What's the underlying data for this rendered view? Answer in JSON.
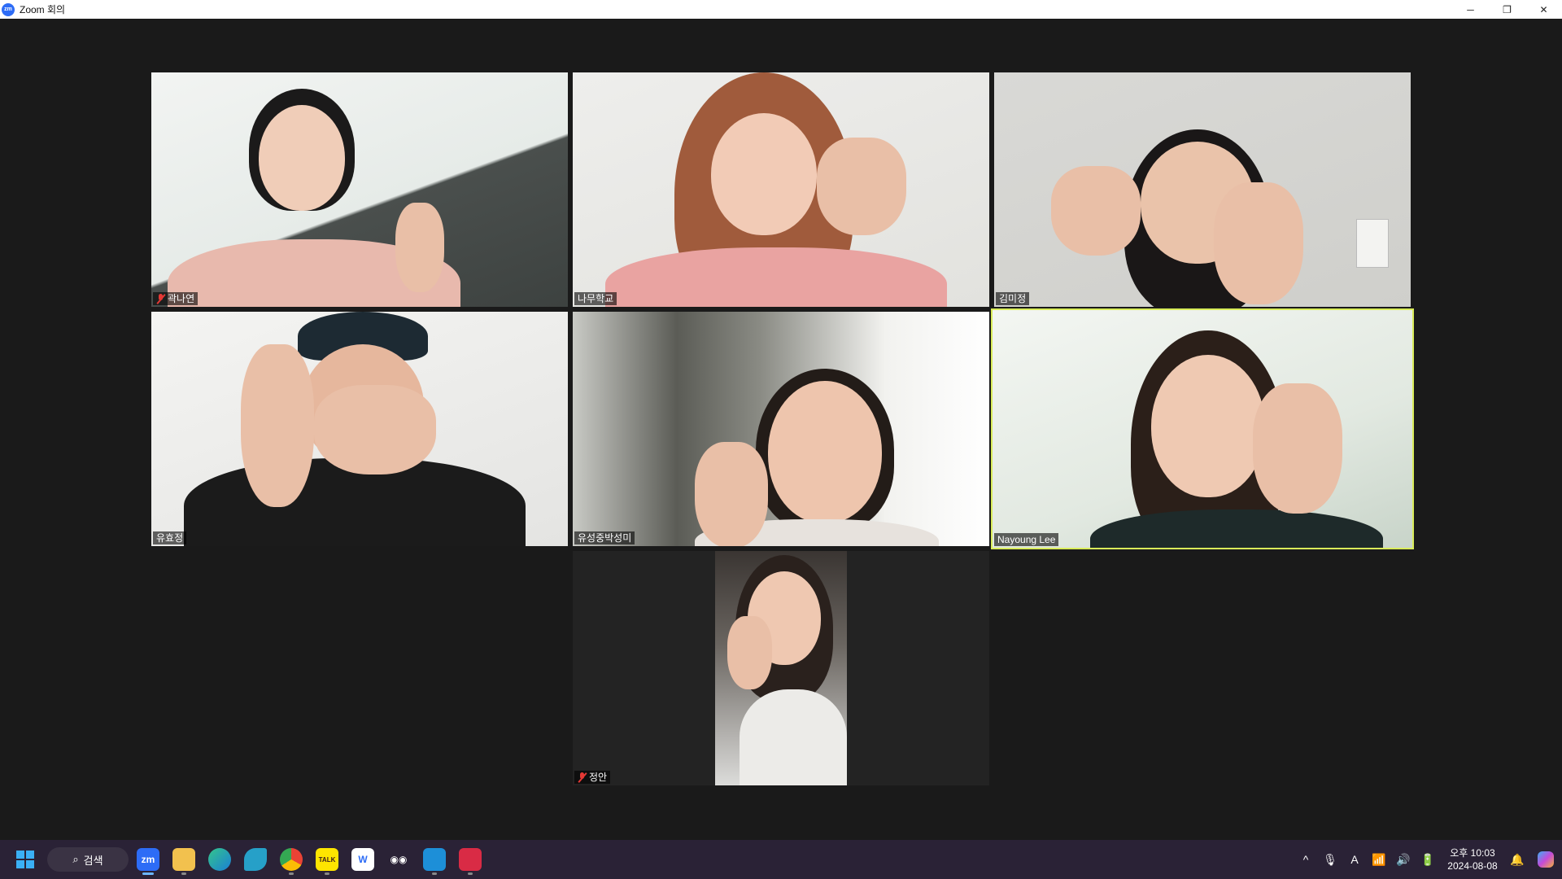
{
  "window": {
    "title": "Zoom 회의",
    "logo_text": "zm",
    "controls": {
      "minimize": "─",
      "restore": "❐",
      "close": "✕"
    }
  },
  "participants": [
    {
      "name": "곽나연",
      "muted": true
    },
    {
      "name": "나무학교",
      "muted": false
    },
    {
      "name": "김미정",
      "muted": false
    },
    {
      "name": "유효정",
      "muted": false
    },
    {
      "name": "유성중박성미",
      "muted": false
    },
    {
      "name": "Nayoung Lee",
      "muted": false,
      "active_speaker": true
    },
    {
      "name": "정안",
      "muted": true
    }
  ],
  "colors": {
    "active_speaker_border": "#d9ec59",
    "muted_icon": "#e53935",
    "taskbar_bg": "#2a2236",
    "meeting_bg": "#1a1a1a"
  },
  "taskbar": {
    "search_label": "검색",
    "apps": [
      {
        "name": "zoom",
        "label": "zm",
        "running": true,
        "active": true
      },
      {
        "name": "file-explorer",
        "label": "",
        "running": true
      },
      {
        "name": "edge",
        "label": "",
        "running": false
      },
      {
        "name": "app-bird",
        "label": "",
        "running": false
      },
      {
        "name": "chrome",
        "label": "",
        "running": true
      },
      {
        "name": "kakaotalk",
        "label": "TALK",
        "running": true
      },
      {
        "name": "word-w",
        "label": "W",
        "running": false
      },
      {
        "name": "app-eyes",
        "label": "",
        "running": false
      },
      {
        "name": "app-blue",
        "label": "",
        "running": true
      },
      {
        "name": "app-red",
        "label": "",
        "running": true
      }
    ],
    "tray": {
      "chevron": "^",
      "mic": "🎙",
      "ime": "A",
      "wifi": "📶",
      "volume": "🔊",
      "battery": "🔋",
      "time": "오후 10:03",
      "date": "2024-08-08",
      "bell": "🔔"
    }
  }
}
